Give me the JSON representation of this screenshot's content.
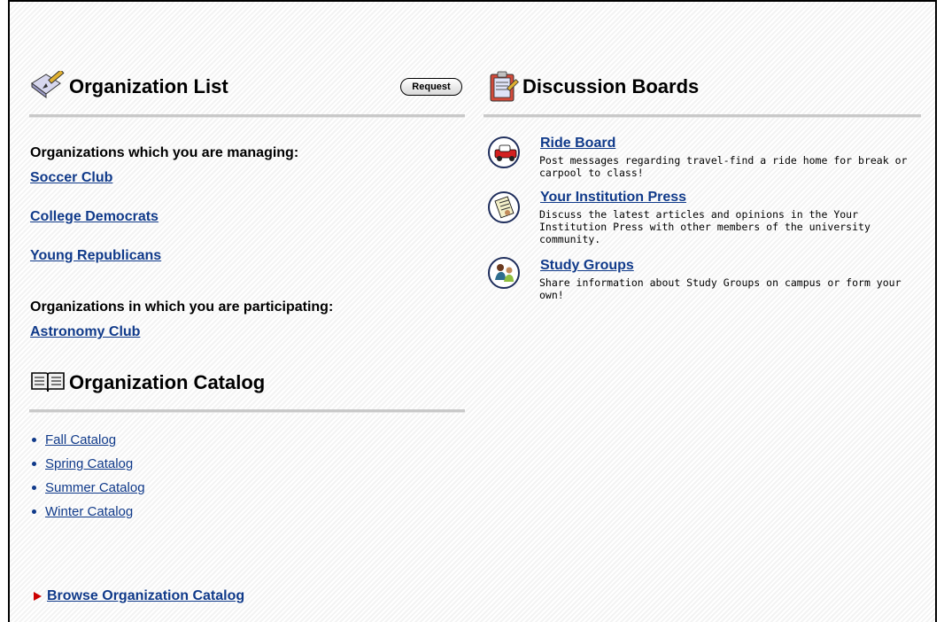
{
  "organization_list": {
    "title": "Organization List",
    "request_label": "Request",
    "managing_heading": "Organizations which you are managing:",
    "managing": [
      "Soccer Club",
      "College Democrats",
      "Young Republicans"
    ],
    "participating_heading": "Organizations in which you are participating:",
    "participating": [
      "Astronomy Club"
    ]
  },
  "organization_catalog": {
    "title": "Organization Catalog",
    "items": [
      "Fall Catalog",
      "Spring Catalog",
      "Summer Catalog",
      "Winter Catalog"
    ]
  },
  "browse_link": "Browse Organization Catalog",
  "discussion_boards": {
    "title": "Discussion Boards",
    "boards": [
      {
        "title": "Ride Board",
        "description": "Post messages regarding travel-find a ride home for break or carpool to class!",
        "icon": "car-icon"
      },
      {
        "title": "Your Institution Press",
        "description": "Discuss the latest articles and opinions in the Your Institution Press with other members of the university community.",
        "icon": "newspaper-icon"
      },
      {
        "title": "Study Groups",
        "description": "Share information about Study Groups on campus or form your own!",
        "icon": "study-group-icon"
      }
    ]
  },
  "colors": {
    "link": "#103a8a",
    "rule": "#c9c9c9",
    "arrow": "#cc0000"
  }
}
